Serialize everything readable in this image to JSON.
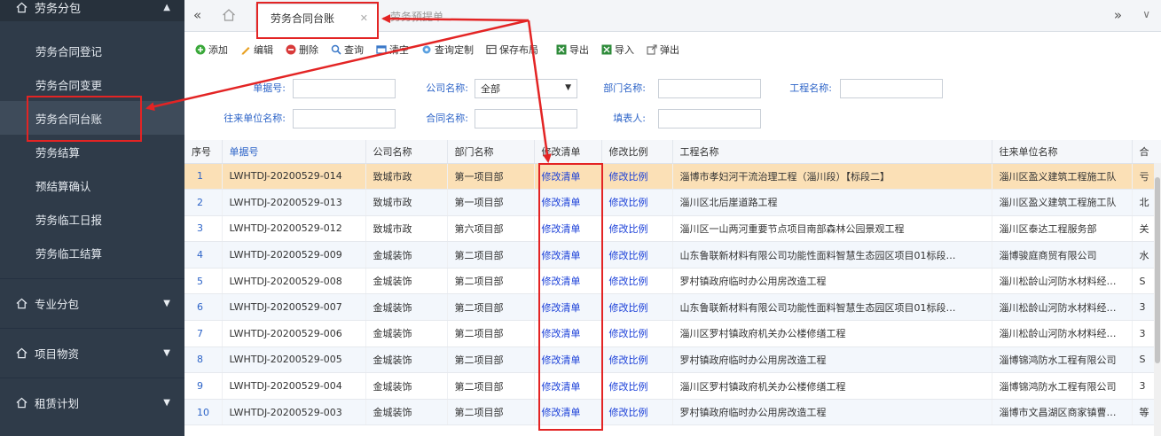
{
  "sidebar": {
    "group_open": "劳务分包",
    "items": [
      {
        "label": "劳务合同登记"
      },
      {
        "label": "劳务合同变更"
      },
      {
        "label": "劳务合同台账"
      },
      {
        "label": "劳务结算"
      },
      {
        "label": "预结算确认"
      },
      {
        "label": "劳务临工日报"
      },
      {
        "label": "劳务临工结算"
      }
    ],
    "groups_closed": [
      {
        "label": "专业分包"
      },
      {
        "label": "项目物资"
      },
      {
        "label": "租赁计划"
      }
    ]
  },
  "tabs": {
    "active": "劳务合同台账",
    "ghost": "劳务预提单"
  },
  "toolbar": {
    "add": "添加",
    "edit": "编辑",
    "delete": "删除",
    "query": "查询",
    "clear": "清空",
    "query_custom": "查询定制",
    "save_layout": "保存布局",
    "export": "导出",
    "import": "导入",
    "popup": "弹出"
  },
  "filters": {
    "doc_no": "单据号:",
    "company": "公司名称:",
    "company_value": "全部",
    "dept": "部门名称:",
    "project": "工程名称:",
    "partner": "往来单位名称:",
    "contract": "合同名称:",
    "filler": "填表人:"
  },
  "table": {
    "headers": [
      "序号",
      "单据号",
      "公司名称",
      "部门名称",
      "修改清单",
      "修改比例",
      "工程名称",
      "往来单位名称",
      "合"
    ],
    "rows": [
      [
        "1",
        "LWHTDJ-20200529-014",
        "致城市政",
        "第一项目部",
        "修改清单",
        "修改比例",
        "淄博市孝妇河干流治理工程（淄川段）【标段二】",
        "淄川区盈义建筑工程施工队",
        "亏"
      ],
      [
        "2",
        "LWHTDJ-20200529-013",
        "致城市政",
        "第一项目部",
        "修改清单",
        "修改比例",
        "淄川区北后崖道路工程",
        "淄川区盈义建筑工程施工队",
        "北"
      ],
      [
        "3",
        "LWHTDJ-20200529-012",
        "致城市政",
        "第六项目部",
        "修改清单",
        "修改比例",
        "淄川区一山两河重要节点项目南部森林公园景观工程",
        "淄川区泰达工程服务部",
        "关"
      ],
      [
        "4",
        "LWHTDJ-20200529-009",
        "金城装饰",
        "第二项目部",
        "修改清单",
        "修改比例",
        "山东鲁联新材料有限公司功能性面料智慧生态园区项目01标段…",
        "淄博骏庭商贸有限公司",
        "水"
      ],
      [
        "5",
        "LWHTDJ-20200529-008",
        "金城装饰",
        "第二项目部",
        "修改清单",
        "修改比例",
        "罗村镇政府临时办公用房改造工程",
        "淄川松龄山河防水材料经…",
        "S"
      ],
      [
        "6",
        "LWHTDJ-20200529-007",
        "金城装饰",
        "第二项目部",
        "修改清单",
        "修改比例",
        "山东鲁联新材料有限公司功能性面料智慧生态园区项目01标段…",
        "淄川松龄山河防水材料经…",
        "3"
      ],
      [
        "7",
        "LWHTDJ-20200529-006",
        "金城装饰",
        "第二项目部",
        "修改清单",
        "修改比例",
        "淄川区罗村镇政府机关办公楼修缮工程",
        "淄川松龄山河防水材料经…",
        "3"
      ],
      [
        "8",
        "LWHTDJ-20200529-005",
        "金城装饰",
        "第二项目部",
        "修改清单",
        "修改比例",
        "罗村镇政府临时办公用房改造工程",
        "淄博锦鸿防水工程有限公司",
        "S"
      ],
      [
        "9",
        "LWHTDJ-20200529-004",
        "金城装饰",
        "第二项目部",
        "修改清单",
        "修改比例",
        "淄川区罗村镇政府机关办公楼修缮工程",
        "淄博锦鸿防水工程有限公司",
        "3"
      ],
      [
        "10",
        "LWHTDJ-20200529-003",
        "金城装饰",
        "第二项目部",
        "修改清单",
        "修改比例",
        "罗村镇政府临时办公用房改造工程",
        "淄博市文昌湖区商家镇曹…",
        "等"
      ]
    ]
  },
  "colors": {
    "annotation": "#e32424",
    "link": "#1a3fd8",
    "sidebar": "#2f3b49"
  }
}
